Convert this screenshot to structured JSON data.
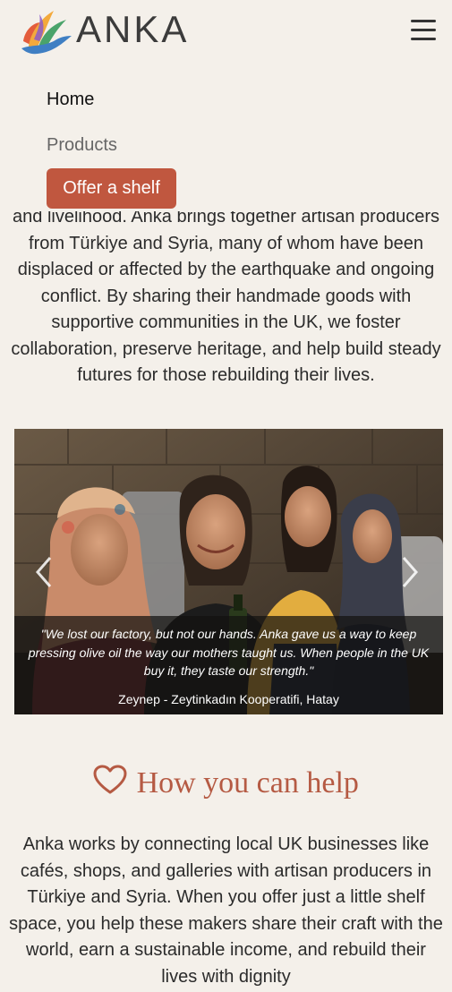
{
  "header": {
    "logo_text": "ANKA",
    "menu_icon": "hamburger-icon"
  },
  "nav": {
    "items": [
      {
        "label": "Home"
      },
      {
        "label": "Products"
      }
    ],
    "cta_label": "Offer a shelf"
  },
  "intro": {
    "text": "and livelihood. Anka brings together artisan producers from Türkiye and Syria, many of whom have been displaced or affected by the earthquake and ongoing conflict. By sharing their handmade goods with supportive communities in the UK, we foster collaboration, preserve heritage, and help build steady futures for those rebuilding their lives."
  },
  "carousel": {
    "prev_icon": "chevron-left-icon",
    "next_icon": "chevron-right-icon",
    "quote": "\"We lost our factory, but not our hands. Anka gave us a way to keep pressing olive oil the way our mothers taught us. When people in the UK buy it, they taste our strength.\"",
    "attribution": "Zeynep - Zeytinkadın Kooperatifi, Hatay"
  },
  "help": {
    "icon": "heart-icon",
    "title": "How you can help",
    "text": "Anka works by connecting local UK businesses like cafés, shops, and galleries with artisan producers in Türkiye and Syria. When you offer just a little shelf space, you help these makers share their craft with the world, earn a sustainable income, and rebuild their lives with dignity"
  },
  "colors": {
    "background": "#f4f0ea",
    "accent": "#c0573f",
    "heading": "#b55a43",
    "text": "#2b2b2b"
  }
}
